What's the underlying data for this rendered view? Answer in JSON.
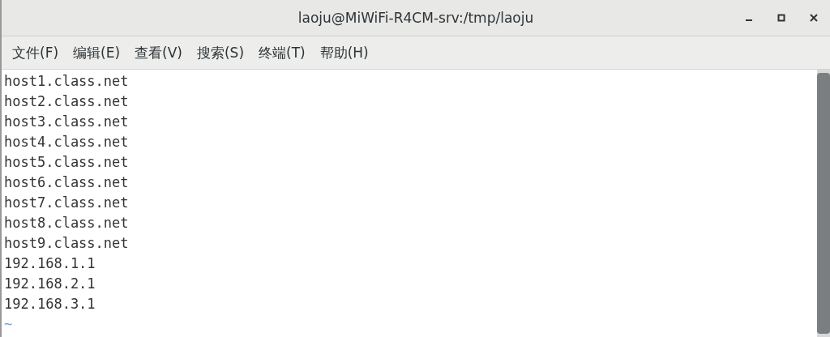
{
  "window": {
    "title": "laoju@MiWiFi-R4CM-srv:/tmp/laoju"
  },
  "menu": [
    {
      "label": "文件(F)"
    },
    {
      "label": "编辑(E)"
    },
    {
      "label": "查看(V)"
    },
    {
      "label": "搜索(S)"
    },
    {
      "label": "终端(T)"
    },
    {
      "label": "帮助(H)"
    }
  ],
  "terminal": {
    "lines": [
      {
        "kind": "text",
        "text": "host1.class.net"
      },
      {
        "kind": "text",
        "text": "host2.class.net"
      },
      {
        "kind": "text",
        "text": "host3.class.net"
      },
      {
        "kind": "text",
        "text": "host4.class.net"
      },
      {
        "kind": "text",
        "text": "host5.class.net"
      },
      {
        "kind": "text",
        "text": "host6.class.net"
      },
      {
        "kind": "text",
        "text": "host7.class.net"
      },
      {
        "kind": "text",
        "text": "host8.class.net"
      },
      {
        "kind": "text",
        "text": "host9.class.net"
      },
      {
        "kind": "text",
        "text": "192.168.1.1"
      },
      {
        "kind": "text",
        "text": "192.168.2.1"
      },
      {
        "kind": "text",
        "text": "192.168.3.1"
      },
      {
        "kind": "filler",
        "text": "~"
      }
    ]
  }
}
